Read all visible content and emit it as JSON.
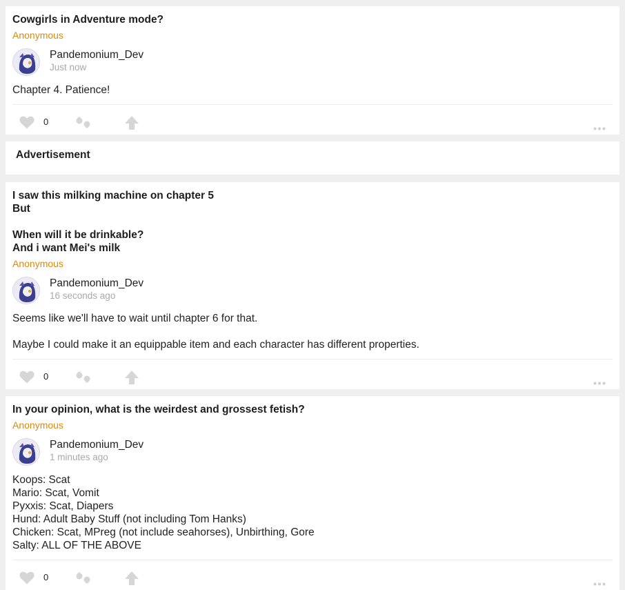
{
  "posts": [
    {
      "question": "Cowgirls in Adventure mode?",
      "asker": "Anonymous",
      "author": "Pandemonium_Dev",
      "time": "Just now",
      "answer": "Chapter 4. Patience!",
      "likes": "0"
    },
    {
      "question": "I saw this milking machine on chapter 5\nBut\n\nWhen will it be drinkable?\nAnd i want Mei's milk",
      "asker": "Anonymous",
      "author": "Pandemonium_Dev",
      "time": "16 seconds ago",
      "answer": "Seems like we'll have to wait until chapter 6 for that.\n\nMaybe I could make it an equippable item and each character has different properties.",
      "likes": "0"
    },
    {
      "question": "In your opinion, what is the weirdest and grossest fetish?",
      "asker": "Anonymous",
      "author": "Pandemonium_Dev",
      "time": "1 minutes ago",
      "answer": "Koops: Scat\nMario: Scat, Vomit\nPyxxis: Scat, Diapers\nHund: Adult Baby Stuff (not including Tom Hanks)\nChicken: Scat, MPreg (not include seahorses), Unbirthing, Gore\nSalty: ALL OF THE ABOVE",
      "likes": "0"
    }
  ],
  "advertisement": {
    "label": "Advertisement"
  },
  "colors": {
    "anonymous": "#e08a00",
    "icon_gray": "#d6d6d6",
    "background": "#efefef"
  },
  "icons": [
    "heart-icon",
    "quote-icon",
    "share-arrow-icon",
    "more-dots-icon"
  ]
}
